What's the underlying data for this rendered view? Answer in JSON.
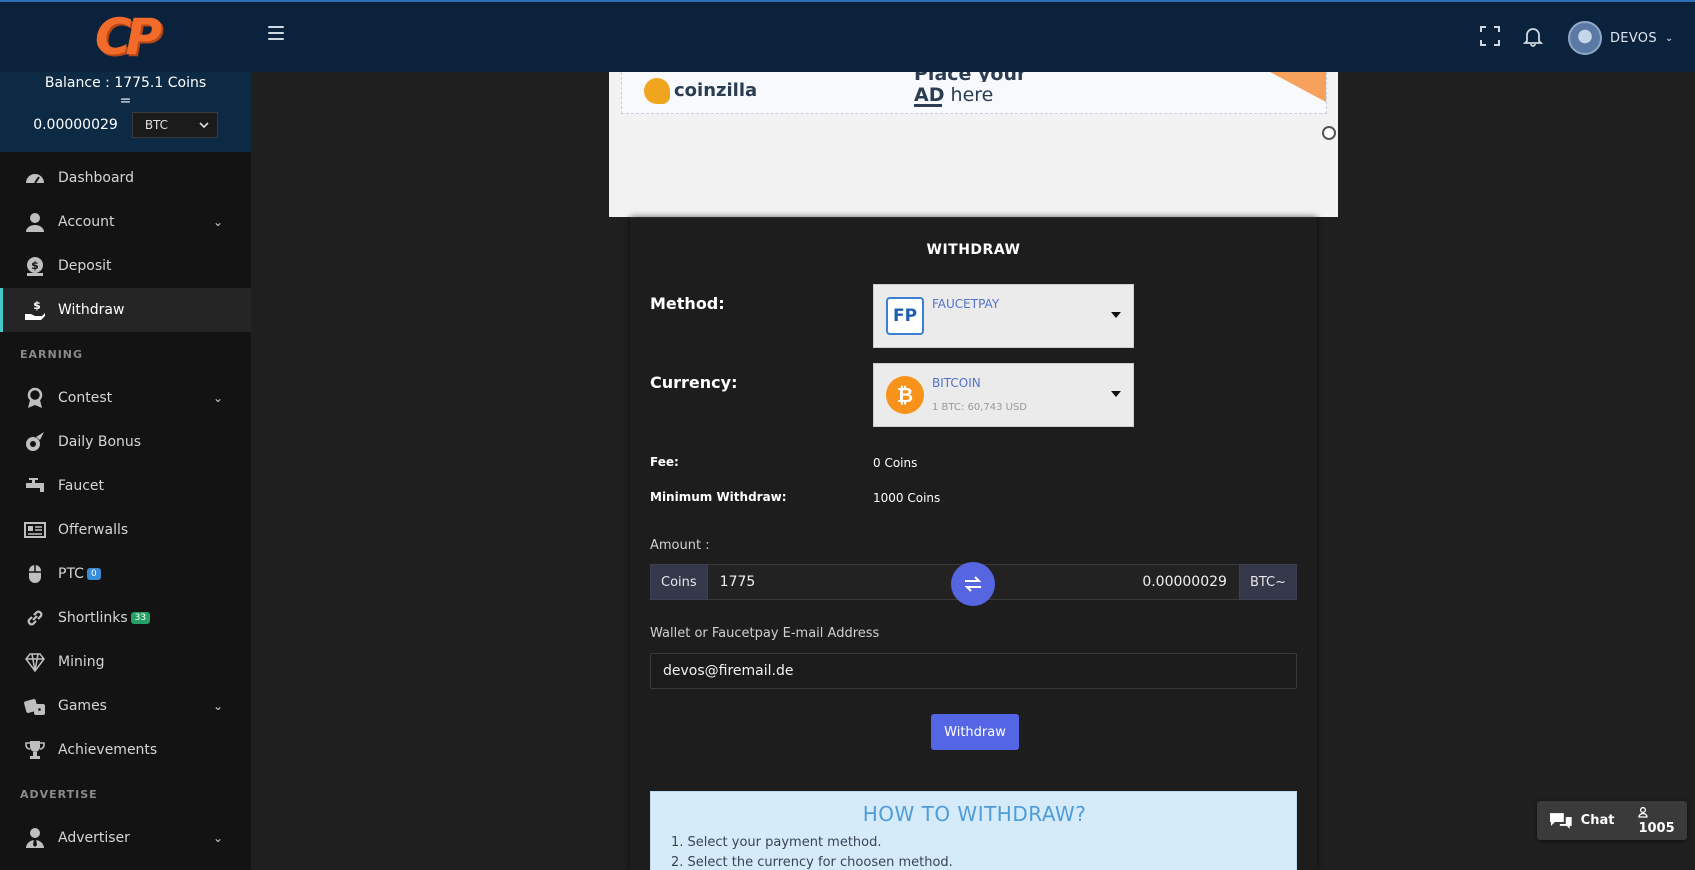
{
  "header": {
    "logo_text": "CP",
    "username": "DEVOS"
  },
  "balance": {
    "line": "Balance : 1775.1 Coins",
    "equals": "=",
    "btc_value": "0.00000029",
    "currency_selected": "BTC"
  },
  "sidebar": {
    "items": [
      {
        "label": "Dashboard",
        "icon": "speedometer-icon"
      },
      {
        "label": "Account",
        "icon": "user-icon",
        "expandable": true
      },
      {
        "label": "Deposit",
        "icon": "money-bag-icon"
      },
      {
        "label": "Withdraw",
        "icon": "hand-dollar-icon",
        "active": true
      }
    ],
    "section_earning": "EARNING",
    "earning_items": [
      {
        "label": "Contest",
        "icon": "medal-icon",
        "expandable": true
      },
      {
        "label": "Daily Bonus",
        "icon": "meteor-icon"
      },
      {
        "label": "Faucet",
        "icon": "faucet-icon"
      },
      {
        "label": "Offerwalls",
        "icon": "newspaper-icon"
      },
      {
        "label": "PTC",
        "icon": "mouse-icon",
        "badge": "0"
      },
      {
        "label": "Shortlinks",
        "icon": "link-icon",
        "badge": "33"
      },
      {
        "label": "Mining",
        "icon": "diamond-icon"
      },
      {
        "label": "Games",
        "icon": "dice-icon",
        "expandable": true
      },
      {
        "label": "Achievements",
        "icon": "trophy-icon"
      }
    ],
    "section_advertise": "ADVERTISE",
    "advertise_items": [
      {
        "label": "Advertiser",
        "icon": "advertiser-icon",
        "expandable": true
      }
    ]
  },
  "ad": {
    "brand": "coinzilla",
    "text_top": "Place your",
    "text_strong": "AD",
    "text_rest": " here"
  },
  "withdraw": {
    "title": "WITHDRAW",
    "method_label": "Method:",
    "method_value": "FAUCETPAY",
    "method_icon_text": "FP",
    "currency_label": "Currency:",
    "currency_value": "BITCOIN",
    "currency_rate": "1 BTC: 60,743 USD",
    "fee_label": "Fee:",
    "fee_value": "0 Coins",
    "min_label": "Minimum Withdraw:",
    "min_value": "1000 Coins",
    "amount_label": "Amount :",
    "coins_addon": "Coins",
    "coins_amount": "1775",
    "btc_amount": "0.00000029",
    "btc_addon": "BTC~",
    "wallet_label": "Wallet or Faucetpay E-mail Address",
    "wallet_value": "devos@firemail.de",
    "submit_label": "Withdraw"
  },
  "howto": {
    "title": "HOW TO WITHDRAW?",
    "steps": [
      "1. Select your payment method.",
      "2. Select the currency for choosen method."
    ]
  },
  "chat": {
    "label": "Chat",
    "count": "1005"
  },
  "colors": {
    "topbar": "#0b223c",
    "sidebar": "#131313",
    "accent": "#5466e6",
    "logo": "#f26b2a",
    "active_border": "#47c7c7"
  }
}
